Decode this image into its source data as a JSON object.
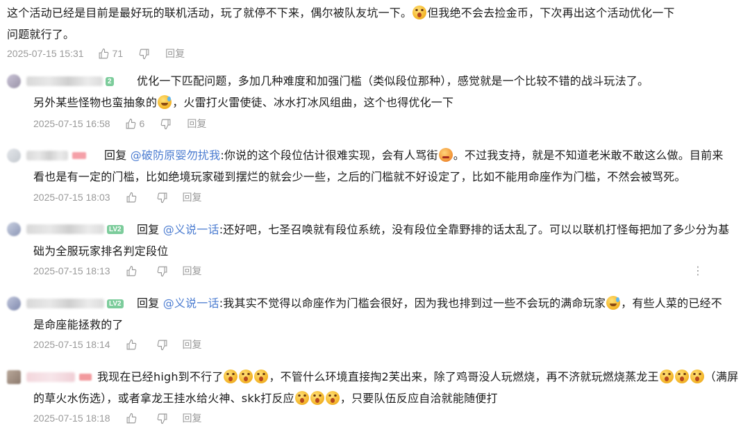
{
  "top_comment": {
    "line1": "这个活动已经是目前是最好玩的联机活动，玩了就停不下来，偶尔被队友坑一下。",
    "line1b": "但我绝不会去捡金币，下次再出这个活动优化一下",
    "line2": "问题就行了。",
    "time": "2025-07-15 15:31",
    "likes": "71",
    "reply_label": "回复"
  },
  "replies": [
    {
      "level": "2",
      "line1": "优化一下匹配问题，多加几种难度和加强门槛（类似段位那种），感觉就是一个比较不错的战斗玩法了。",
      "line2a": "另外某些怪物也蛮抽象的",
      "line2b": "，火雷打火雷使徒、冰水打冰风组曲，这个也得优化一下",
      "time": "2025-07-15 16:58",
      "likes": "6",
      "reply_label": "回复"
    },
    {
      "reply_word": "回复",
      "mention": "@破防原婴勿扰我",
      "line1a": ":你说的这个段位估计很难实现，会有人骂街",
      "line1b": "。不过我支持，就是不知道老米敢不敢这么做。目前来",
      "line2": "看也是有一定的门槛，比如绝境玩家碰到摆烂的就会少一些，之后的门槛就不好设定了，比如不能用命座作为门槛，不然会被骂死。",
      "time": "2025-07-15 18:03",
      "reply_label": "回复"
    },
    {
      "level": "LV2",
      "reply_word": "回复",
      "mention": "@义说一话",
      "line1": ":还好吧，七圣召唤就有段位系统，没有段位全靠野排的话太乱了。可以以联机打怪每把加了多少分为基",
      "line2": "础为全服玩家排名判定段位",
      "time": "2025-07-15 18:13",
      "reply_label": "回复",
      "more_icon": "⋮"
    },
    {
      "level": "LV2",
      "reply_word": "回复",
      "mention": "@义说一话",
      "line1a": ":我其实不觉得以命座作为门槛会很好，因为我也排到过一些不会玩的满命玩家",
      "line1b": "，有些人菜的已经不",
      "line2": "是命座能拯救的了",
      "time": "2025-07-15 18:14",
      "reply_label": "回复"
    },
    {
      "line1a": "我现在已经high到不行了",
      "line1b": "，不管什么环境直接掏2芙出来，除了鸡哥没人玩燃烧，再不济就玩燃烧蒸龙王",
      "line1c": "（满屏",
      "line2a": "的草火水伤选），或者拿龙王挂水给火神、skk打反应",
      "line2b": "，只要队伍反应自洽就能随便打",
      "time": "2025-07-15 18:18",
      "reply_label": "回复"
    }
  ]
}
